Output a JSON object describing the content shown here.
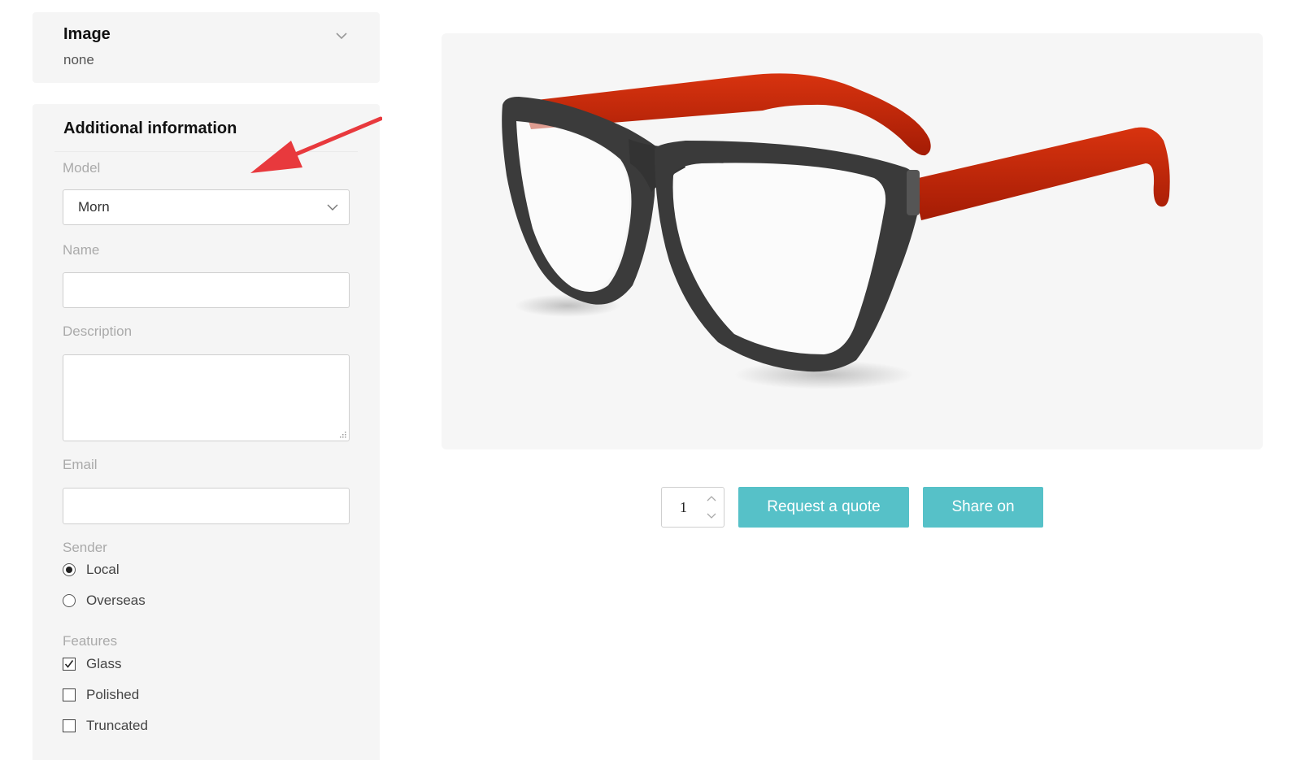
{
  "image_section": {
    "title": "Image",
    "value": "none",
    "expand_icon": "chevron-down-icon"
  },
  "additional_info": {
    "title": "Additional information",
    "model": {
      "label": "Model",
      "selected": "Morn"
    },
    "name": {
      "label": "Name",
      "value": ""
    },
    "description": {
      "label": "Description",
      "value": ""
    },
    "email": {
      "label": "Email",
      "value": ""
    },
    "sender": {
      "label": "Sender",
      "options": [
        {
          "label": "Local",
          "selected": true
        },
        {
          "label": "Overseas",
          "selected": false
        }
      ]
    },
    "features": {
      "label": "Features",
      "options": [
        {
          "label": "Glass",
          "checked": true
        },
        {
          "label": "Polished",
          "checked": false
        },
        {
          "label": "Truncated",
          "checked": false
        }
      ]
    }
  },
  "product": {
    "image_subject": "eyeglasses with black frame and red temples",
    "quantity": "1",
    "request_quote_label": "Request a quote",
    "share_label": "Share on"
  },
  "colors": {
    "accent": "#56c1c8",
    "annotation_arrow": "#e8393d",
    "frame": "#3a3a3a",
    "temple": "#c0260a"
  }
}
